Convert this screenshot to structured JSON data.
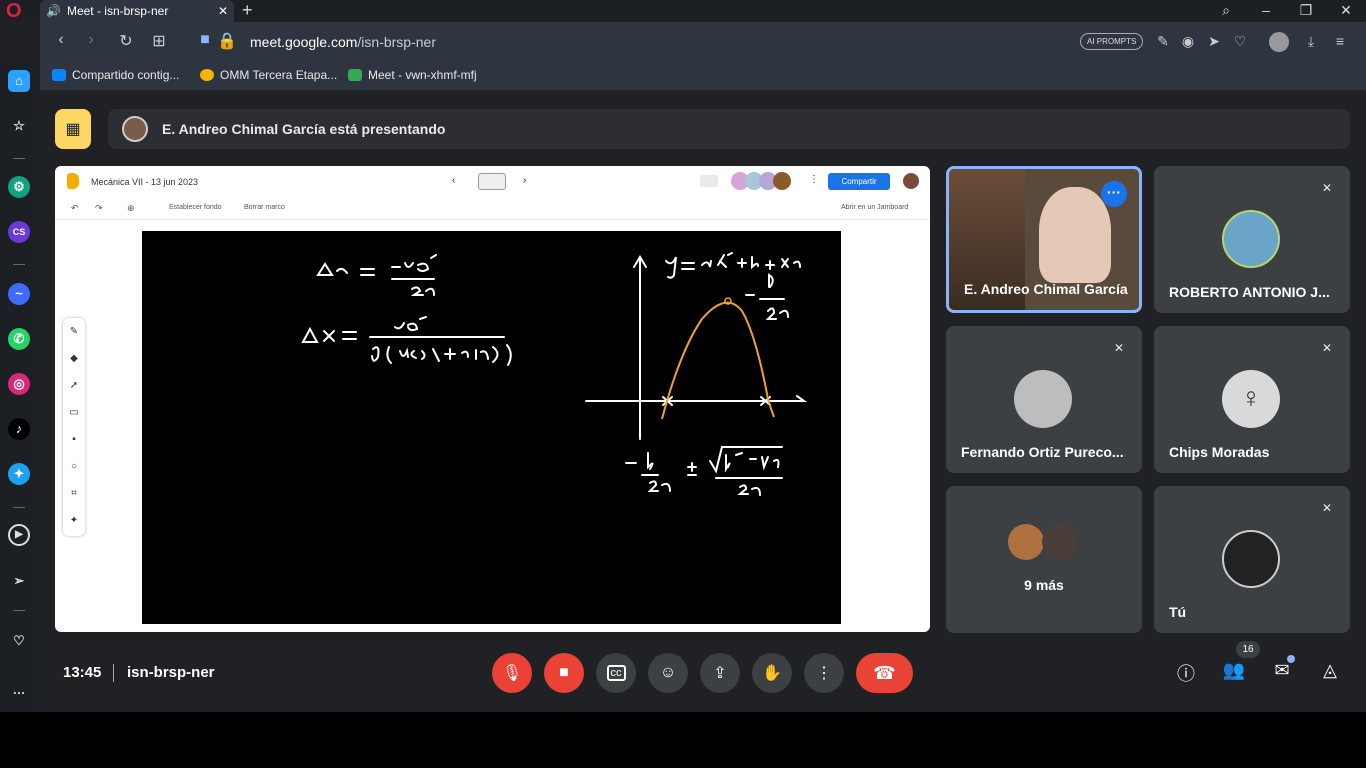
{
  "browser": {
    "tab_title": "Meet - isn-brsp-ner",
    "url_host": "meet.google.com",
    "url_path": "/isn-brsp-ner",
    "ai_prompts": "AI PROMPTS",
    "bookmarks": [
      "Compartido contig...",
      "OMM Tercera Etapa...",
      "Meet - vwn-xhmf-mfj"
    ]
  },
  "meet": {
    "presenting_text": "E. Andreo Chimal García está presentando",
    "time": "13:45",
    "meeting_code": "isn-brsp-ner",
    "participants_count": "16"
  },
  "jamboard": {
    "title": "Mecánica VII - 13 jun 2023",
    "share": "Compartir",
    "set_background": "Establecer fondo",
    "clear_frame": "Borrar marco",
    "open_in_jamboard": "Abrir en un Jamboard"
  },
  "tiles": [
    {
      "name": "E. Andreo Chimal García"
    },
    {
      "name": "ROBERTO ANTONIO J..."
    },
    {
      "name": "Fernando Ortiz Pureco..."
    },
    {
      "name": "Chips Moradas"
    },
    {
      "name": "9 más"
    },
    {
      "name": "Tú"
    }
  ],
  "colors": {
    "accent": "#1a73e8",
    "danger": "#ea4335",
    "presenting": "#fdd663"
  }
}
